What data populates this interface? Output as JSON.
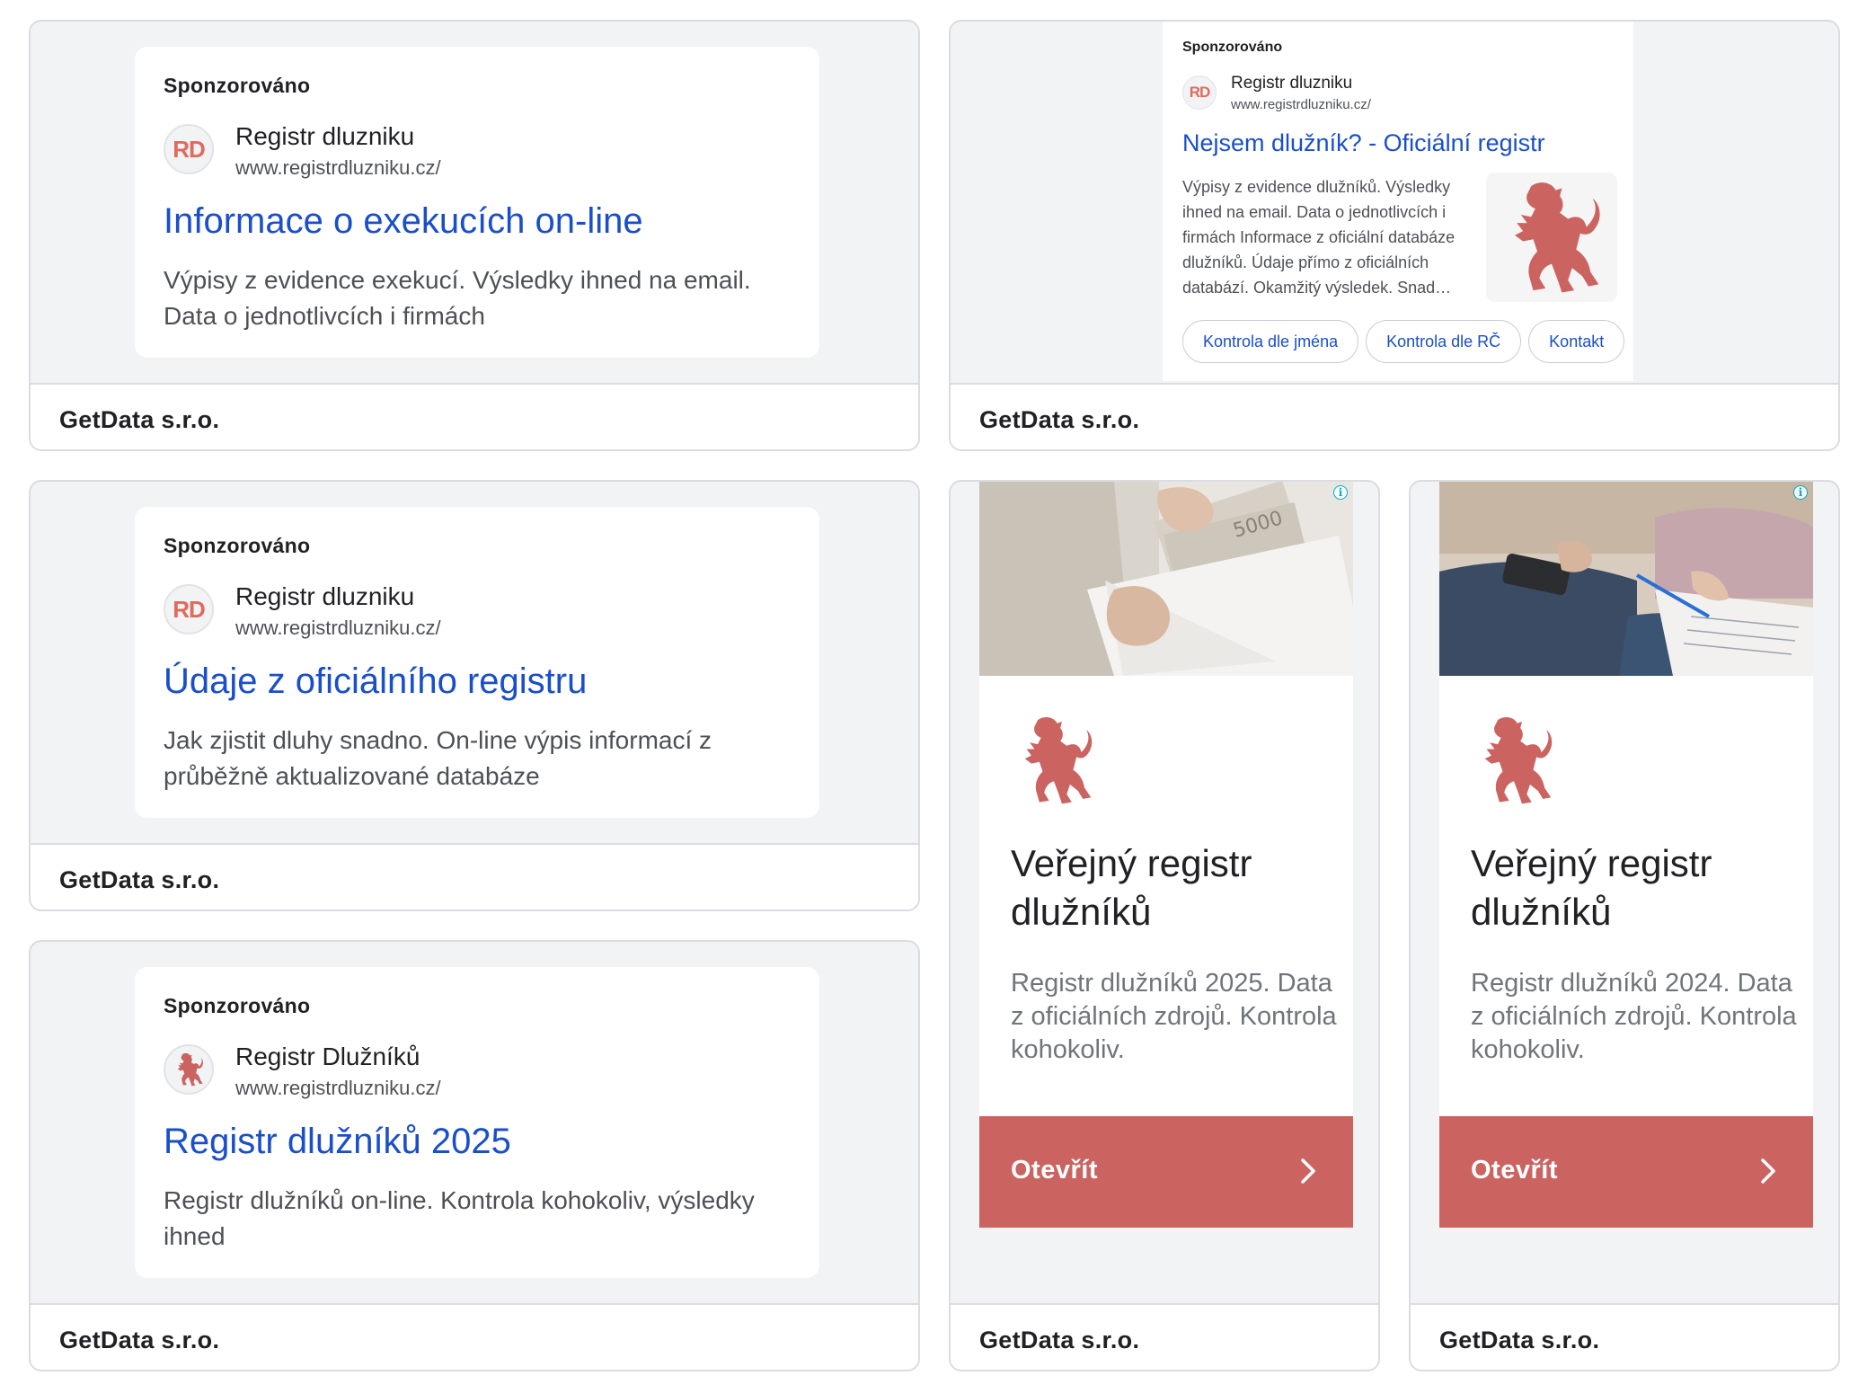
{
  "cards": [
    {
      "advertiser": "GetData s.r.o.",
      "sponsored": "Sponzorováno",
      "favicon": "RD",
      "site_name": "Registr dluzniku",
      "site_url": "www.registrdluzniku.cz/",
      "headline": "Informace o exekucích on-line",
      "description": "Výpisy z evidence exekucí. Výsledky ihned na email. Data o jednotlivcích i firmách"
    },
    {
      "advertiser": "GetData s.r.o.",
      "sponsored": "Sponzorováno",
      "favicon": "RD",
      "site_name": "Registr dluzniku",
      "site_url": "www.registrdluzniku.cz/",
      "headline": "Nejsem dlužník? - Oficiální registr",
      "description": "Výpisy z evidence dlužníků. Výsledky ihned na email. Data o jednotlivcích i firmách Informace z oficiální databáze dlužníků. Údaje přímo z oficiálních databází. Okamžitý výsledek. Snad…",
      "thumbnail_icon": "lion-icon",
      "sitelinks": [
        "Kontrola dle jména",
        "Kontrola dle RČ",
        "Kontakt"
      ]
    },
    {
      "advertiser": "GetData s.r.o.",
      "sponsored": "Sponzorováno",
      "favicon": "RD",
      "site_name": "Registr dluzniku",
      "site_url": "www.registrdluzniku.cz/",
      "headline": "Údaje z oficiálního registru",
      "description": "Jak zjistit dluhy snadno. On-line výpis informací z průběžně aktualizované databáze"
    },
    {
      "advertiser": "GetData s.r.o.",
      "sponsored": "Sponzorováno",
      "favicon_icon": "lion-icon",
      "site_name": "Registr Dlužníků",
      "site_url": "www.registrdluzniku.cz/",
      "headline": "Registr dlužníků 2025",
      "description": "Registr dlužníků on-line. Kontrola kohokoliv, výsledky ihned"
    },
    {
      "advertiser": "GetData s.r.o.",
      "photo": "envelope-with-banknotes",
      "title": "Veřejný registr dlužníků",
      "description": "Registr dlužníků 2025. Data z oficiálních zdrojů. Kontrola kohokoliv.",
      "cta": "Otevřít",
      "info_icon": "i"
    },
    {
      "advertiser": "GetData s.r.o.",
      "photo": "couple-with-calculator-and-documents",
      "title": "Veřejný registr dlužníků",
      "description": "Registr dlužníků 2024. Data z oficiálních zdrojů. Kontrola kohokoliv.",
      "cta": "Otevřít",
      "info_icon": "i"
    }
  ],
  "colors": {
    "link_blue": "#1a4fc9",
    "brand_red": "#cb6461",
    "card_bg": "#f1f3f4",
    "border": "#dadce0"
  }
}
